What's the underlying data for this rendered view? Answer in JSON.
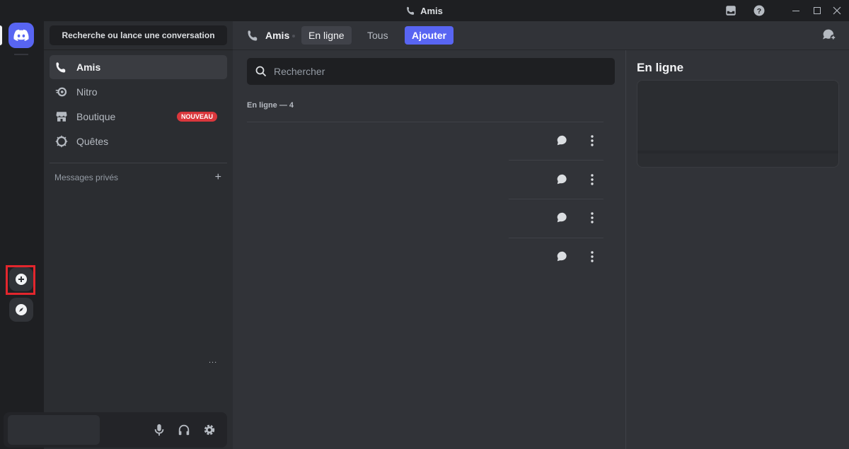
{
  "window": {
    "title": "Amis",
    "controls": [
      "inbox-icon",
      "help-icon",
      "minimize-icon",
      "maximize-icon",
      "close-icon"
    ]
  },
  "rail": {
    "home_icon": "discord-logo-icon",
    "add_server_icon": "plus-circle-icon",
    "discover_icon": "compass-icon"
  },
  "annotation": {
    "highlight_color": "#e3262d"
  },
  "sidebar": {
    "search_label": "Recherche ou lance une conversation",
    "items": [
      {
        "label": "Amis",
        "icon": "friends-icon",
        "active": true
      },
      {
        "label": "Nitro",
        "icon": "nitro-icon"
      },
      {
        "label": "Boutique",
        "icon": "shop-icon",
        "badge": "NOUVEAU"
      },
      {
        "label": "Quêtes",
        "icon": "quests-icon"
      }
    ],
    "dm_header": "Messages privés",
    "dm_add": "+",
    "more": "..."
  },
  "user_panel": {
    "controls": [
      "microphone-icon",
      "headphones-icon",
      "settings-icon"
    ]
  },
  "header": {
    "title": "Amis",
    "tabs": [
      {
        "label": "En ligne",
        "active": true
      },
      {
        "label": "Tous"
      },
      {
        "label": "Ajouter",
        "primary": true
      }
    ],
    "new_group_icon": "new-group-dm-icon"
  },
  "friends": {
    "search_placeholder": "Rechercher",
    "section_label": "En ligne — 4",
    "rows": [
      {
        "actions": [
          "message-icon",
          "more-vertical-icon"
        ]
      },
      {
        "actions": [
          "message-icon",
          "more-vertical-icon"
        ]
      },
      {
        "actions": [
          "message-icon",
          "more-vertical-icon"
        ]
      },
      {
        "actions": [
          "message-icon",
          "more-vertical-icon"
        ]
      }
    ]
  },
  "active_now": {
    "title": "En ligne"
  },
  "colors": {
    "brand": "#5865f2",
    "badge": "#da373c",
    "background": "#313338",
    "sidebar": "#2b2d31",
    "rail": "#1e1f22"
  }
}
